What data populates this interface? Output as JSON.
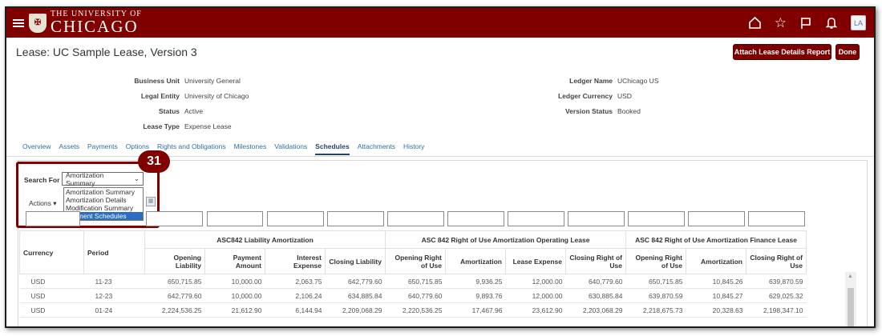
{
  "header": {
    "university_small": "THE UNIVERSITY OF",
    "university_big": "CHICAGO",
    "avatar": "LA"
  },
  "page": {
    "title": "Lease: UC Sample Lease, Version 3",
    "attach_button": "Attach Lease Details Report",
    "done_button": "Done"
  },
  "details": {
    "left": [
      {
        "label": "Business Unit",
        "value": "University General"
      },
      {
        "label": "Legal Entity",
        "value": "University of Chicago"
      },
      {
        "label": "Status",
        "value": "Active"
      },
      {
        "label": "Lease Type",
        "value": "Expense Lease"
      }
    ],
    "right": [
      {
        "label": "Ledger Name",
        "value": "UChicago US"
      },
      {
        "label": "Ledger Currency",
        "value": "USD"
      },
      {
        "label": "Version Status",
        "value": "Booked"
      }
    ]
  },
  "tabs": [
    "Overview",
    "Assets",
    "Payments",
    "Options",
    "Rights and Obligations",
    "Milestones",
    "Validations",
    "Schedules",
    "Attachments",
    "History"
  ],
  "active_tab": "Schedules",
  "search": {
    "label": "Search For",
    "selected": "Amortization Summary",
    "options": [
      "Amortization Summary",
      "Amortization Details",
      "Modification Summary",
      "Payment Schedules"
    ],
    "highlighted": "Payment Schedules",
    "actions_label": "Actions"
  },
  "step_badge": "31",
  "table": {
    "group_headers": [
      "ASC842 Liability Amortization",
      "ASC 842 Right of Use Amortization Operating Lease",
      "ASC 842 Right of Use Amortization Finance Lease"
    ],
    "columns": [
      "Currency",
      "Period",
      "Opening Liability",
      "Payment Amount",
      "Interest Expense",
      "Closing Liability",
      "Opening Right of Use",
      "Amortization",
      "Lease Expense",
      "Closing Right of Use",
      "Opening Right of Use",
      "Amortization",
      "Closing Right of Use"
    ],
    "rows": [
      [
        "USD",
        "11-23",
        "650,715.85",
        "10,000.00",
        "2,063.75",
        "642,779.60",
        "650,715.85",
        "9,936.25",
        "12,000.00",
        "640,779.60",
        "650,715.85",
        "10,845.26",
        "639,870.59"
      ],
      [
        "USD",
        "12-23",
        "642,779.60",
        "10,000.00",
        "2,106.24",
        "634,885.84",
        "640,779.60",
        "9,893.76",
        "12,000.00",
        "630,885.84",
        "639,870.59",
        "10,845.27",
        "629,025.32"
      ],
      [
        "USD",
        "01-24",
        "2,224,536.25",
        "21,612.90",
        "6,144.94",
        "2,209,068.29",
        "2,220,536.25",
        "17,467.96",
        "23,612.90",
        "2,203,068.29",
        "2,218,675.73",
        "20,328.63",
        "2,198,347.10"
      ]
    ]
  }
}
